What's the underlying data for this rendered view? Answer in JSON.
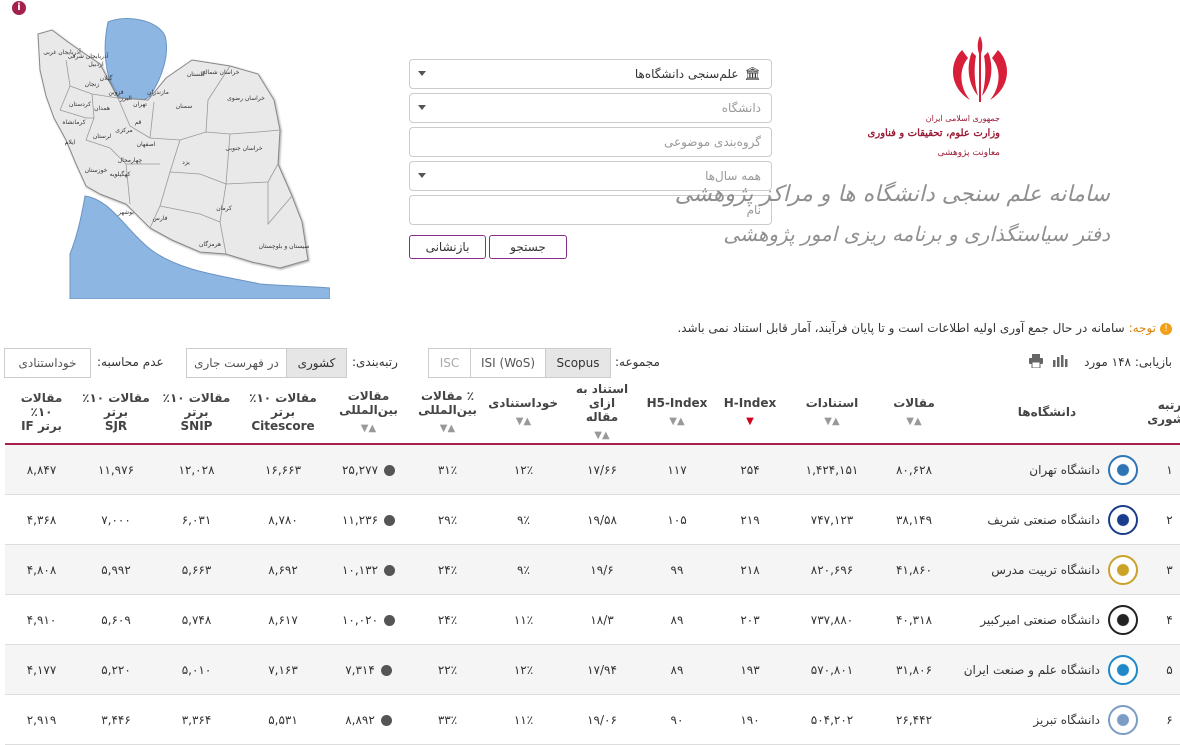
{
  "header": {
    "emblem_lines": [
      "جمهوری اسلامی ایران",
      "وزارت علوم، تحقیقات و فناوری",
      "معاونت پژوهشی"
    ],
    "system_title": "سامانه علم سنجی دانشگاه ها و مراکز پژوهشی",
    "office_title": "دفتر سیاستگذاری و برنامه ریزی امور پژوهشی"
  },
  "map": {
    "provinces": [
      "آذربایجان غربی",
      "آذربایجان شرقی",
      "اردبیل",
      "گیلان",
      "زنجان",
      "کردستان",
      "کرمانشاه",
      "همدان",
      "قزوین",
      "مازندران",
      "گلستان",
      "خراسان شمالی",
      "خراسان رضوی",
      "سمنان",
      "تهران",
      "البرز",
      "قم",
      "مرکزی",
      "لرستان",
      "ایلام",
      "خوزستان",
      "اصفهان",
      "یزد",
      "خراسان جنوبی",
      "کهگیلویه",
      "چهارمحال",
      "فارس",
      "کرمان",
      "بوشهر",
      "هرمزگان",
      "سیستان و بلوچستان"
    ]
  },
  "form": {
    "type_select": "علم‌سنجی دانشگاه‌ها",
    "university_placeholder": "دانشگاه",
    "subject_placeholder": "گروه‌بندی موضوعی",
    "year_select": "همه سال‌ها",
    "name_placeholder": "نام",
    "search_label": "جستجو",
    "reset_label": "بازنشانی"
  },
  "notice": {
    "tag": "توجه:",
    "text": "سامانه در حال جمع آوری اولیه اطلاعات است و تا پایان فرآیند، آمار قابل استناد نمی باشد."
  },
  "toolbar": {
    "results_label": "بازیابی:",
    "results_count": "۱۴۸ مورد",
    "collection_label": "مجموعه:",
    "collections": [
      "Scopus",
      "ISI (WoS)",
      "ISC"
    ],
    "ranking_label": "رتبه‌بندی:",
    "ranking_options": [
      "کشوری",
      "در فهرست جاری"
    ],
    "exclude_label": "عدم محاسبه:",
    "exclude_option": "خوداستنادی"
  },
  "table": {
    "headers": [
      {
        "l1": "رتبه",
        "l2": "کشوری"
      },
      {
        "l1": "دانشگاه‌ها",
        "l2": ""
      },
      {
        "l1": "مقالات",
        "l2": ""
      },
      {
        "l1": "استنادات",
        "l2": ""
      },
      {
        "l1": "H-Index",
        "l2": ""
      },
      {
        "l1": "H5-Index",
        "l2": ""
      },
      {
        "l1": "استناد به ازای",
        "l2": "مقاله"
      },
      {
        "l1": "خوداستنادی",
        "l2": ""
      },
      {
        "l1": "٪ مقالات",
        "l2": "بین‌المللی"
      },
      {
        "l1": "مقالات",
        "l2": "بین‌المللی"
      },
      {
        "l1": "مقالات ۱۰٪ برتر",
        "l2": "Citescore"
      },
      {
        "l1": "مقالات ۱۰٪ برتر",
        "l2": "SNIP"
      },
      {
        "l1": "مقالات ۱۰٪ برتر",
        "l2": "SJR"
      },
      {
        "l1": "مقالات ۱۰٪",
        "l2": "برتر IF"
      }
    ],
    "rows": [
      {
        "rank": "۱",
        "name": "دانشگاه تهران",
        "papers": "۸۰,۶۲۸",
        "citations": "۱,۴۲۴,۱۵۱",
        "h": "۲۵۴",
        "h5": "۱۱۷",
        "cpp": "۱۷/۶۶",
        "self": "۱۲٪",
        "intl_pct": "۳۱٪",
        "intl": "۲۵,۲۷۷",
        "cs": "۱۶,۶۶۳",
        "snip": "۱۲,۰۲۸",
        "sjr": "۱۱,۹۷۶",
        "if": "۸,۸۴۷",
        "logo_color": "#2f74b5"
      },
      {
        "rank": "۲",
        "name": "دانشگاه صنعتی شریف",
        "papers": "۳۸,۱۴۹",
        "citations": "۷۴۷,۱۲۳",
        "h": "۲۱۹",
        "h5": "۱۰۵",
        "cpp": "۱۹/۵۸",
        "self": "۹٪",
        "intl_pct": "۲۹٪",
        "intl": "۱۱,۲۳۶",
        "cs": "۸,۷۸۰",
        "snip": "۶,۰۳۱",
        "sjr": "۷,۰۰۰",
        "if": "۴,۳۶۸",
        "logo_color": "#1b3c8c"
      },
      {
        "rank": "۳",
        "name": "دانشگاه تربیت مدرس",
        "papers": "۴۱,۸۶۰",
        "citations": "۸۲۰,۶۹۶",
        "h": "۲۱۸",
        "h5": "۹۹",
        "cpp": "۱۹/۶",
        "self": "۹٪",
        "intl_pct": "۲۴٪",
        "intl": "۱۰,۱۳۲",
        "cs": "۸,۶۹۲",
        "snip": "۵,۶۶۳",
        "sjr": "۵,۹۹۲",
        "if": "۴,۸۰۸",
        "logo_color": "#c9a227"
      },
      {
        "rank": "۴",
        "name": "دانشگاه صنعتی امیرکبیر",
        "papers": "۴۰,۳۱۸",
        "citations": "۷۳۷,۸۸۰",
        "h": "۲۰۳",
        "h5": "۸۹",
        "cpp": "۱۸/۳",
        "self": "۱۱٪",
        "intl_pct": "۲۴٪",
        "intl": "۱۰,۰۲۰",
        "cs": "۸,۶۱۷",
        "snip": "۵,۷۴۸",
        "sjr": "۵,۶۰۹",
        "if": "۴,۹۱۰",
        "logo_color": "#222222"
      },
      {
        "rank": "۵",
        "name": "دانشگاه علم و صنعت ایران",
        "papers": "۳۱,۸۰۶",
        "citations": "۵۷۰,۸۰۱",
        "h": "۱۹۳",
        "h5": "۸۹",
        "cpp": "۱۷/۹۴",
        "self": "۱۲٪",
        "intl_pct": "۲۲٪",
        "intl": "۷,۳۱۴",
        "cs": "۷,۱۶۳",
        "snip": "۵,۰۱۰",
        "sjr": "۵,۲۲۰",
        "if": "۴,۱۷۷",
        "logo_color": "#1e88c8"
      },
      {
        "rank": "۶",
        "name": "دانشگاه تبریز",
        "papers": "۲۶,۴۴۲",
        "citations": "۵۰۴,۲۰۲",
        "h": "۱۹۰",
        "h5": "۹۰",
        "cpp": "۱۹/۰۶",
        "self": "۱۱٪",
        "intl_pct": "۳۳٪",
        "intl": "۸,۸۹۲",
        "cs": "۵,۵۳۱",
        "snip": "۳,۳۶۴",
        "sjr": "۳,۴۴۶",
        "if": "۲,۹۱۹",
        "logo_color": "#7a9cc6"
      }
    ]
  }
}
